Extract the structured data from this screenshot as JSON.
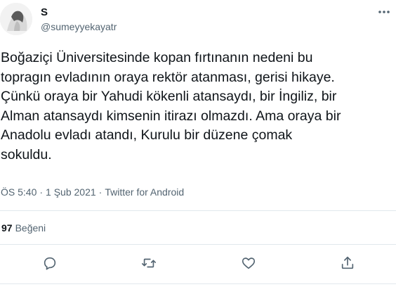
{
  "user": {
    "display_name": "S",
    "handle": "@sumeyyekayatr"
  },
  "tweet": {
    "text": "Boğaziçi Üniversitesinde kopan fırtınanın nedeni bu\ntopragın evladının oraya rektör atanması, gerisi hikaye.\nÇünkü oraya bir Yahudi kökenli atansaydı, bir İngiliz, bir\nAlman atansaydı kimsenin itirazı olmazdı. Ama oraya bir\nAnadolu evladı atandı, Kurulu bir düzene çomak\nsokuldu.",
    "time": "ÖS 5:40",
    "date": "1 Şub 2021",
    "separator": "·",
    "source": "Twitter for Android"
  },
  "stats": {
    "likes_count": "97",
    "likes_label": "Beğeni"
  },
  "icons": {
    "more": "more-options-icon",
    "reply": "reply-icon",
    "retweet": "retweet-icon",
    "like": "like-icon",
    "share": "share-icon"
  },
  "colors": {
    "text_primary": "#0f1419",
    "text_secondary": "#536471",
    "divider": "#e1e8ed"
  }
}
